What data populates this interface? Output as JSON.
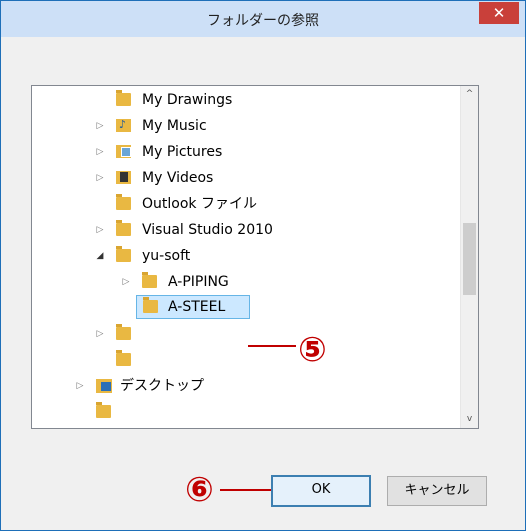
{
  "window": {
    "title": "フォルダーの参照",
    "close_glyph": "✕"
  },
  "tree": {
    "items": [
      {
        "label": "My Drawings",
        "expander": "",
        "icon": "folder-icon"
      },
      {
        "label": "My Music",
        "expander": "▷",
        "icon": "music-folder-icon"
      },
      {
        "label": "My Pictures",
        "expander": "▷",
        "icon": "pictures-folder-icon"
      },
      {
        "label": "My Videos",
        "expander": "▷",
        "icon": "videos-folder-icon"
      },
      {
        "label": "Outlook ファイル",
        "expander": "",
        "icon": "folder-icon"
      },
      {
        "label": "Visual Studio 2010",
        "expander": "▷",
        "icon": "folder-icon"
      },
      {
        "label": "yu-soft",
        "expander": "◢",
        "icon": "folder-icon"
      },
      {
        "label": "A-PIPING",
        "expander": "▷",
        "icon": "folder-icon"
      },
      {
        "label": "A-STEEL",
        "expander": "",
        "icon": "folder-icon",
        "selected": true
      },
      {
        "label": "",
        "expander": "▷",
        "icon": "folder-icon"
      },
      {
        "label": "",
        "expander": "",
        "icon": "folder-icon"
      },
      {
        "label": "デスクトップ",
        "expander": "▷",
        "icon": "desktop-icon"
      }
    ],
    "scroll_up_glyph": "^",
    "scroll_down_glyph": "v"
  },
  "annotations": {
    "step5": "⑤",
    "step6": "⑥"
  },
  "buttons": {
    "ok": "OK",
    "cancel": "キャンセル"
  },
  "colors": {
    "title_bar": "#cde0f7",
    "close": "#c9403a",
    "annotation": "#c00000",
    "selection": "#cce8ff"
  }
}
